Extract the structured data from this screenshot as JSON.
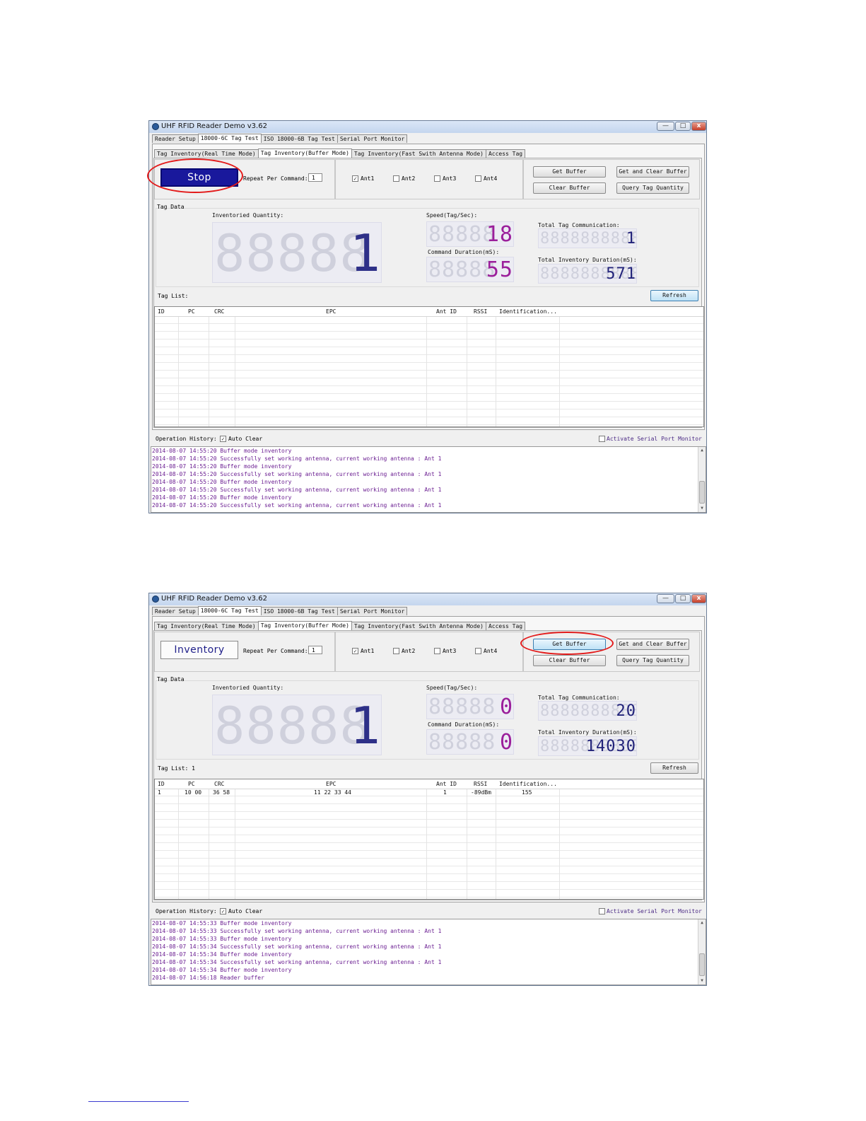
{
  "app": {
    "title": "UHF RFID Reader Demo v3.62",
    "win_min": "—",
    "win_max": "□",
    "win_close": "x"
  },
  "main_tabs": [
    "Reader Setup",
    "18000-6C Tag Test",
    "ISO 18000-6B Tag Test",
    "Serial Port Monitor"
  ],
  "sub_tabs": [
    "Tag Inventory(Real Time Mode)",
    "Tag Inventory(Buffer Mode)",
    "Tag Inventory(Fast Swith Antenna Mode)",
    "Access Tag"
  ],
  "labels": {
    "repeat": "Repeat Per Command:",
    "tag_data": "Tag Data",
    "inventoried_quantity": "Inventoried Quantity:",
    "speed": "Speed(Tag/Sec):",
    "command_duration": "Command Duration(mS):",
    "total_tag_communication": "Total Tag Communication:",
    "total_inventory_duration": "Total Inventory Duration(mS):",
    "refresh": "Refresh",
    "operation_history": "Operation History:",
    "auto_clear": "Auto Clear",
    "activate_serial": "Activate Serial Port Monitor"
  },
  "antennas": [
    "Ant1",
    "Ant2",
    "Ant3",
    "Ant4"
  ],
  "buttons": {
    "get_buffer": "Get Buffer",
    "get_and_clear": "Get and Clear Buffer",
    "clear_buffer": "Clear Buffer",
    "query_tag_quantity": "Query Tag Quantity"
  },
  "columns": [
    "ID",
    "PC",
    "CRC",
    "EPC",
    "Ant ID",
    "RSSI",
    "Identification..."
  ],
  "shot1": {
    "main_button": "Stop",
    "repeat_value": "1",
    "ant_checked": [
      true,
      false,
      false,
      false
    ],
    "auto_clear_checked": true,
    "serial_checked": false,
    "taglist_label": "Tag List:",
    "ghost_big": "88888",
    "ghost_med": "88888",
    "ghost_small": "8888888888",
    "inventoried_quantity": "1",
    "speed": "18",
    "command_duration": "55",
    "total_tag_communication": "1",
    "total_inventory_duration": "571",
    "rows": [],
    "log": [
      "2014-08-07 14:55:20 Buffer mode inventory",
      "2014-08-07 14:55:20 Successfully set working antenna, current working antenna : Ant 1",
      "2014-08-07 14:55:20 Buffer mode inventory",
      "2014-08-07 14:55:20 Successfully set working antenna, current working antenna : Ant 1",
      "2014-08-07 14:55:20 Buffer mode inventory",
      "2014-08-07 14:55:20 Successfully set working antenna, current working antenna : Ant 1",
      "2014-08-07 14:55:20 Buffer mode inventory",
      "2014-08-07 14:55:20 Successfully set working antenna, current working antenna : Ant 1"
    ]
  },
  "shot2": {
    "main_button": "Inventory",
    "repeat_value": "1",
    "ant_checked": [
      true,
      false,
      false,
      false
    ],
    "auto_clear_checked": true,
    "serial_checked": false,
    "taglist_label": "Tag List: 1",
    "ghost_big": "88888",
    "ghost_med": "88888",
    "ghost_small": "8888888888",
    "inventoried_quantity": "1",
    "speed": "0",
    "command_duration": "0",
    "total_tag_communication": "20",
    "total_inventory_duration": "14030",
    "rows": [
      {
        "id": "1",
        "pc": "10 00",
        "crc": "36 58",
        "epc": "11 22 33 44",
        "ant": "1",
        "rssi": "-89dBm",
        "ident": "155"
      }
    ],
    "log": [
      "2014-08-07 14:55:33 Buffer mode inventory",
      "2014-08-07 14:55:33 Successfully set working antenna, current working antenna : Ant 1",
      "2014-08-07 14:55:33 Buffer mode inventory",
      "2014-08-07 14:55:34 Successfully set working antenna, current working antenna : Ant 1",
      "2014-08-07 14:55:34 Buffer mode inventory",
      "2014-08-07 14:55:34 Successfully set working antenna, current working antenna : Ant 1",
      "2014-08-07 14:55:34 Buffer mode inventory",
      "2014-08-07 14:56:18 Reader buffer"
    ]
  },
  "colors": {
    "stop_button": "#19189c",
    "digit_blue": "#2e3088",
    "digit_purple": "#9b1f9b",
    "log_text": "#6b1f92",
    "highlight": "#e31a1a"
  }
}
